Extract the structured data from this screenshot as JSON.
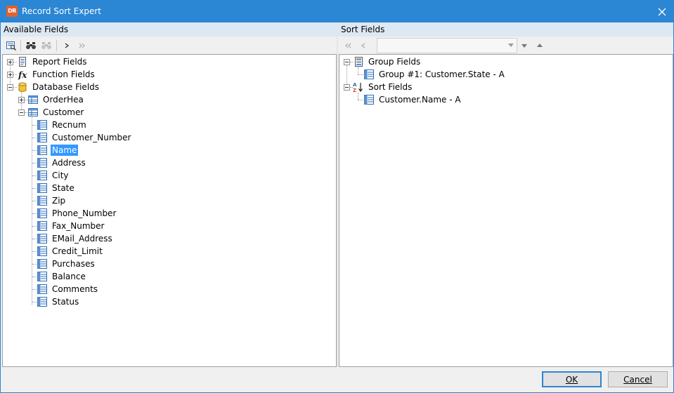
{
  "window": {
    "title": "Record Sort Expert",
    "icon_text": "DR"
  },
  "left_pane": {
    "header": "Available Fields",
    "tree": {
      "report_fields": "Report Fields",
      "function_fields": "Function Fields",
      "database_fields": "Database Fields",
      "orderhea": "OrderHea",
      "customer": "Customer",
      "customer_fields": [
        "Recnum",
        "Customer_Number",
        "Name",
        "Address",
        "City",
        "State",
        "Zip",
        "Phone_Number",
        "Fax_Number",
        "EMail_Address",
        "Credit_Limit",
        "Purchases",
        "Balance",
        "Comments",
        "Status"
      ],
      "selected": "Name"
    }
  },
  "right_pane": {
    "header": "Sort Fields",
    "tree": {
      "group_fields": "Group Fields",
      "group_item": "Group #1: Customer.State - A",
      "sort_fields": "Sort Fields",
      "sort_item": "Customer.Name - A"
    }
  },
  "buttons": {
    "ok": "OK",
    "cancel": "Cancel"
  },
  "colors": {
    "accent": "#2b86d4",
    "selection": "#3399ff",
    "header_bg": "#dce8f3"
  }
}
